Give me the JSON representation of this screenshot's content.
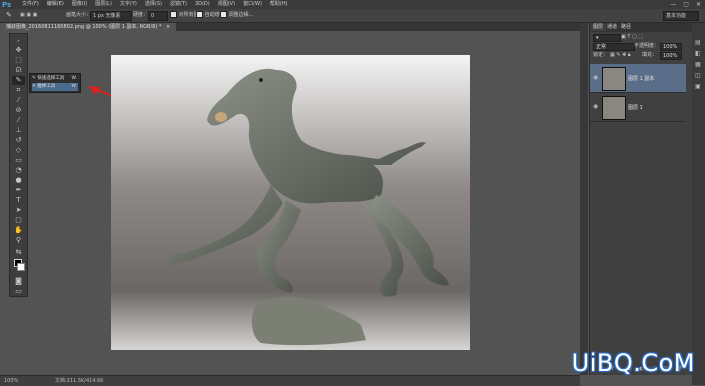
{
  "app": {
    "logo": "Ps"
  },
  "menu": {
    "items": [
      "文件(F)",
      "编辑(E)",
      "图像(I)",
      "图层(L)",
      "文字(Y)",
      "选择(S)",
      "滤镜(T)",
      "3D(D)",
      "视图(V)",
      "窗口(W)",
      "帮助(H)"
    ],
    "window_controls": [
      "—",
      "▢",
      "✕"
    ]
  },
  "options": {
    "brush_size_label": "画笔大小：",
    "brush_size_value": "1 px 无像素",
    "mode_label": "硬度：",
    "mode_value": "0",
    "check1_label": "对所有图层",
    "check2_label": "自动增强",
    "refine_label": "调整边缘...",
    "workspace": "基本功能"
  },
  "document": {
    "tab_label": "捕获图像_20160811160802.png @ 100% (图层 1 副本, RGB/8) *",
    "close": "×"
  },
  "tools": {
    "selected_flyout": [
      {
        "label": "快速选择工具",
        "key": "W"
      },
      {
        "label": "魔棒工具",
        "key": "W"
      }
    ]
  },
  "status": {
    "zoom": "100%",
    "doc": "文档:211.5K/414.6K"
  },
  "panels": {
    "tabs": [
      "图层",
      "通道",
      "路径"
    ],
    "blend_mode": "正常",
    "opacity_label": "不透明度：",
    "opacity": "100%",
    "lock_label": "锁定：",
    "fill_label": "填充：",
    "fill": "100%",
    "layers": [
      {
        "name": "图层 1 副本",
        "selected": true
      },
      {
        "name": "图层 1",
        "selected": false
      }
    ]
  },
  "watermark": "UiBQ.CoM",
  "colors": {
    "accent": "#4a6b8c",
    "arrow": "#e02020",
    "selected_layer": "#5a6e8a"
  }
}
